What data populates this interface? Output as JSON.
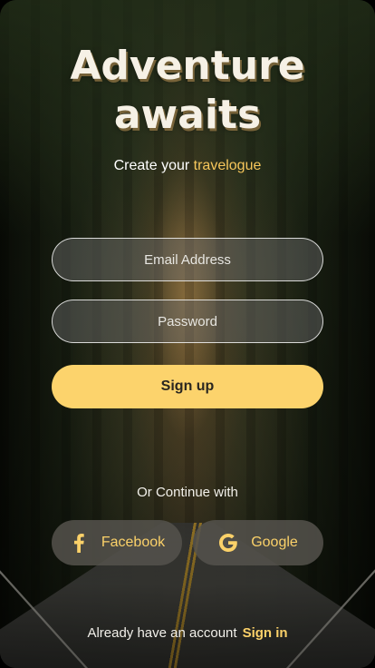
{
  "hero": {
    "title": "Adventure awaits",
    "subtitle_prefix": "Create your ",
    "subtitle_accent": "travelogue"
  },
  "form": {
    "email_placeholder": "Email Address",
    "password_placeholder": "Password",
    "signup_label": "Sign up"
  },
  "social": {
    "divider_text": "Or Continue with",
    "facebook_label": "Facebook",
    "google_label": "Google",
    "facebook_icon": "facebook-icon",
    "google_icon": "google-icon"
  },
  "footer": {
    "prompt": "Already have an account",
    "signin_label": "Sign in"
  },
  "colors": {
    "accent": "#fcd36c",
    "text": "#ffffff"
  }
}
